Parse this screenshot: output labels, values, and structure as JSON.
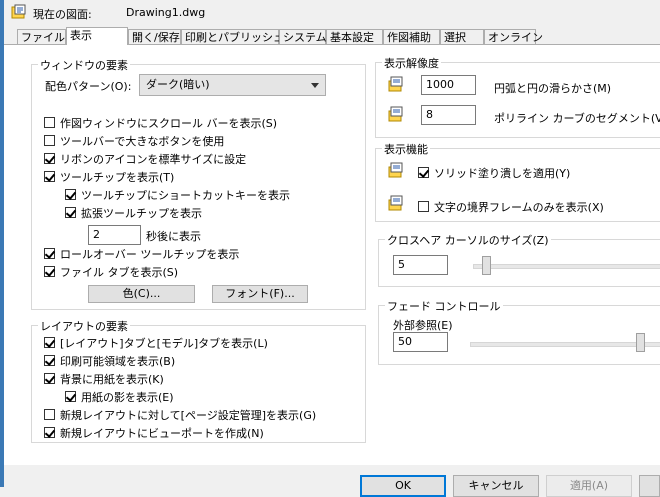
{
  "header": {
    "current_drawing_label": "現在の図面:",
    "drawing_name": "Drawing1.dwg"
  },
  "tabs": [
    {
      "label": "ファイル",
      "active": false
    },
    {
      "label": "表示",
      "active": true
    },
    {
      "label": "開く/保存",
      "active": false
    },
    {
      "label": "印刷とパブリッシュ",
      "active": false
    },
    {
      "label": "システム",
      "active": false
    },
    {
      "label": "基本設定",
      "active": false
    },
    {
      "label": "作図補助",
      "active": false
    },
    {
      "label": "選択",
      "active": false
    },
    {
      "label": "オンライン",
      "active": false
    }
  ],
  "window_elements": {
    "title": "ウィンドウの要素",
    "color_scheme_label": "配色パターン(O):",
    "color_scheme_value": "ダーク(暗い)",
    "options": [
      {
        "label": "作図ウィンドウにスクロール バーを表示(S)",
        "checked": false
      },
      {
        "label": "ツールバーで大きなボタンを使用",
        "checked": false
      },
      {
        "label": "リボンのアイコンを標準サイズに設定",
        "checked": true
      },
      {
        "label": "ツールチップを表示(T)",
        "checked": true
      },
      {
        "label": "ツールチップにショートカットキーを表示",
        "checked": true
      },
      {
        "label": "拡張ツールチップを表示",
        "checked": true
      },
      {
        "label": "ロールオーバー ツールチップを表示",
        "checked": true
      },
      {
        "label": "ファイル タブを表示(S)",
        "checked": true
      }
    ],
    "delay_value": "2",
    "delay_suffix": "秒後に表示",
    "colors_button": "色(C)...",
    "fonts_button": "フォント(F)..."
  },
  "layout_elements": {
    "title": "レイアウトの要素",
    "options": [
      {
        "label": "[レイアウト]タブと[モデル]タブを表示(L)",
        "checked": true
      },
      {
        "label": "印刷可能領域を表示(B)",
        "checked": true
      },
      {
        "label": "背景に用紙を表示(K)",
        "checked": true
      },
      {
        "label": "用紙の影を表示(E)",
        "checked": true
      },
      {
        "label": "新規レイアウトに対して[ページ設定管理]を表示(G)",
        "checked": false
      },
      {
        "label": "新規レイアウトにビューポートを作成(N)",
        "checked": true
      }
    ]
  },
  "display_resolution": {
    "title": "表示解像度",
    "arc_smoothness_value": "1000",
    "arc_smoothness_label": "円弧と円の滑らかさ(M)",
    "polyline_segments_value": "8",
    "polyline_segments_label": "ポリライン カーブのセグメント(V)"
  },
  "display_performance": {
    "title": "表示機能",
    "options": [
      {
        "label": "ソリッド塗り潰しを適用(Y)",
        "checked": true
      },
      {
        "label": "文字の境界フレームのみを表示(X)",
        "checked": false
      }
    ]
  },
  "crosshair": {
    "title": "クロスヘア カーソルのサイズ(Z)",
    "value": "5",
    "slider_fraction": 0.05
  },
  "fade_control": {
    "title": "フェード コントロール",
    "xref_label": "外部参照(E)",
    "value": "50",
    "slider_fraction": 0.9
  },
  "footer": {
    "ok": "OK",
    "cancel": "キャンセル",
    "apply": "適用(A)"
  },
  "colors": {
    "accent_blue": "#0078d7",
    "window_frame": "#3b79b5"
  }
}
